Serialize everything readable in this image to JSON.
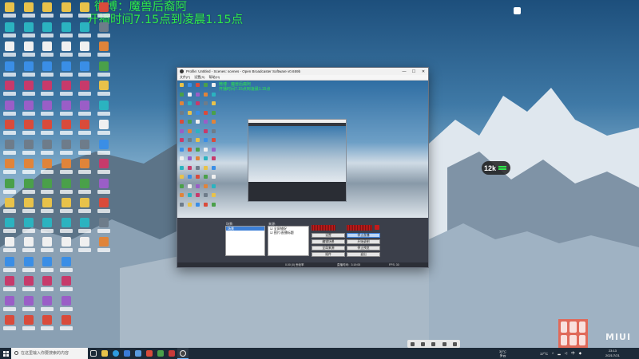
{
  "overlay": {
    "line1": "微博：魔兽后裔阿",
    "line2": "开播时间7.15点到凌晨1.15点"
  },
  "obs": {
    "title": "Profile: Untitled - Scenes: scenes - Open Broadcaster Software v0.659b",
    "menu": [
      "文件(F)",
      "设置(S)",
      "帮助(H)"
    ],
    "window_buttons": [
      "—",
      "☐",
      "✕"
    ],
    "preview_text_1": "微博：魔兽后裔阿",
    "preview_text_2": "开播时间7.15点到凌晨1.15点",
    "scenes_label": "场景:",
    "scene_selected": "场景",
    "sources_label": "来源:",
    "sources": [
      "☑ 全屏捕捉",
      "☑ 图片/直播标题"
    ],
    "buttons": {
      "settings": "设置",
      "stop_stream": "停止直播",
      "edit_scene": "编辑场景",
      "start_recording": "开始录制",
      "global_sources": "全局来源",
      "plugins": "插件",
      "exit": "退出",
      "preview": "停止预览"
    },
    "status": {
      "dropped": "0.00 (0) 丢帧率",
      "time": "直播时间：3:19:05",
      "fps": "FPS: 30"
    }
  },
  "live_widget": {
    "value": "12k"
  },
  "mi_logo": "MIUI",
  "taskbar": {
    "search_placeholder": "在这里输入你要搜索的内容",
    "weather_temp": "30°C",
    "weather_desc": "多云",
    "tray_temp": "17°C",
    "tray_lang": "中",
    "clock_time": "23:13",
    "clock_date": "2021/7/21"
  },
  "desktop_icon_colors": [
    "#e8c24a",
    "#3a8ee6",
    "#d94b3b",
    "#4aa04a",
    "#f0f0f0",
    "#9a5ec7",
    "#e0843a",
    "#2bb3c0",
    "#c73a6b",
    "#6e7c8a"
  ]
}
